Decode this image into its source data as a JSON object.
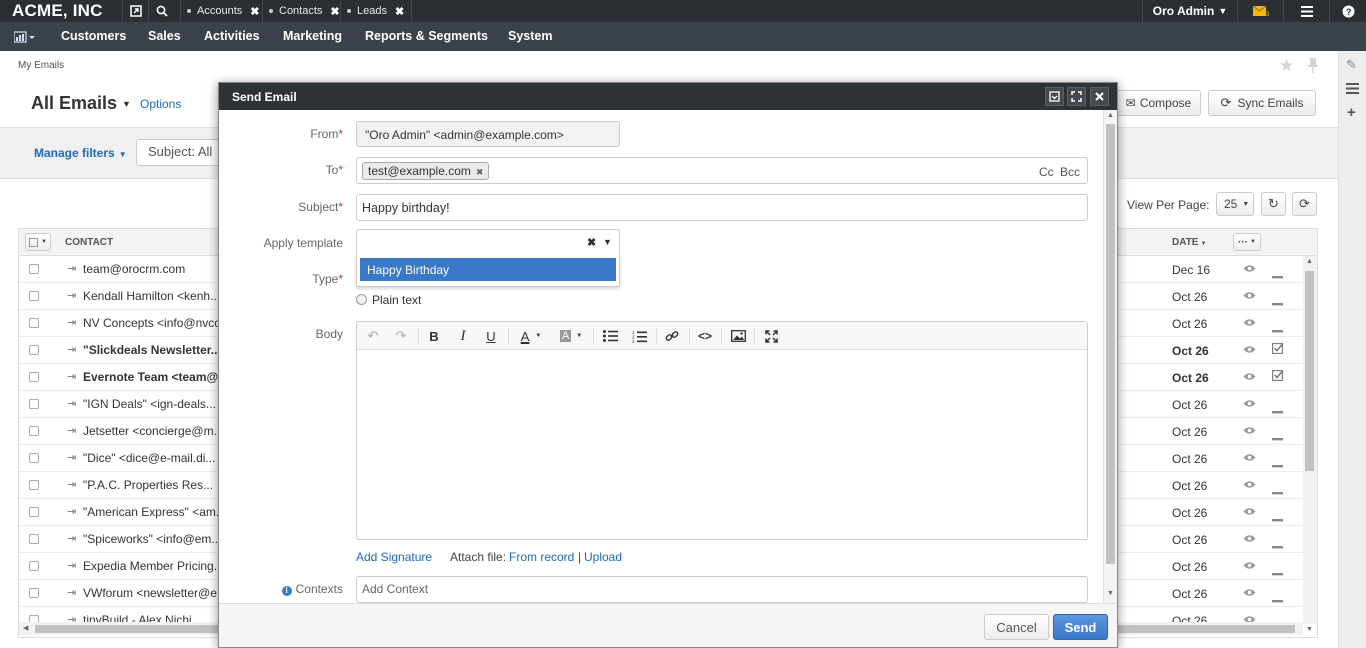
{
  "topbar": {
    "logo": "ACME, INC",
    "tabs": [
      {
        "label": "Accounts"
      },
      {
        "label": "Contacts"
      },
      {
        "label": "Leads"
      }
    ],
    "user": "Oro Admin",
    "close": "✖"
  },
  "menu": [
    "Customers",
    "Sales",
    "Activities",
    "Marketing",
    "Reports & Segments",
    "System"
  ],
  "breadcrumb": "My Emails",
  "page": {
    "title": "All Emails",
    "options": "Options",
    "compose": "Compose",
    "sync": "Sync Emails",
    "manage_filters": "Manage filters",
    "subject_filter": "Subject: All",
    "view_per_page": "View Per Page:",
    "per_page": "25"
  },
  "grid": {
    "col_contact": "CONTACT",
    "col_date": "DATE",
    "rows": [
      {
        "contact": "team@orocrm.com",
        "date": "Dec 16",
        "bold": false,
        "read": false
      },
      {
        "contact": "Kendall Hamilton <kenh...",
        "date": "Oct 26",
        "bold": false,
        "read": false
      },
      {
        "contact": "NV Concepts <info@nvco",
        "date": "Oct 26",
        "bold": false,
        "read": false
      },
      {
        "contact": "\"Slickdeals Newsletter...",
        "date": "Oct 26",
        "bold": true,
        "read": true
      },
      {
        "contact": "Evernote Team <team@",
        "date": "Oct 26",
        "bold": true,
        "read": true
      },
      {
        "contact": "\"IGN Deals\" <ign-deals...",
        "date": "Oct 26",
        "bold": false,
        "read": false
      },
      {
        "contact": "Jetsetter <concierge@m...",
        "date": "Oct 26",
        "bold": false,
        "read": false
      },
      {
        "contact": "\"Dice\" <dice@e-mail.di...",
        "date": "Oct 26",
        "bold": false,
        "read": false
      },
      {
        "contact": "\"P.A.C. Properties Res...",
        "date": "Oct 26",
        "bold": false,
        "read": false
      },
      {
        "contact": "\"American Express\" <am...",
        "date": "Oct 26",
        "bold": false,
        "read": false
      },
      {
        "contact": "\"Spiceworks\" <info@em...",
        "date": "Oct 26",
        "bold": false,
        "read": false
      },
      {
        "contact": "Expedia Member Pricing...",
        "date": "Oct 26",
        "bold": false,
        "read": false
      },
      {
        "contact": "VWforum <newsletter@e...",
        "date": "Oct 26",
        "bold": false,
        "read": false
      },
      {
        "contact": "tinyBuild - Alex Nichi",
        "date": "Oct 26",
        "bold": false,
        "read": false
      }
    ]
  },
  "modal": {
    "title": "Send Email",
    "from_label": "From",
    "from_value": "\"Oro Admin\" <admin@example.com>",
    "to_label": "To",
    "to_tag": "test@example.com",
    "cc": "Cc",
    "bcc": "Bcc",
    "subject_label": "Subject",
    "subject_value": "Happy birthday!",
    "template_label": "Apply template",
    "template_option": "Happy Birthday",
    "type_label": "Type",
    "plain_text": "Plain text",
    "body_label": "Body",
    "add_signature": "Add Signature",
    "attach_file": "Attach file:",
    "from_record": "From record",
    "sep": "|",
    "upload": "Upload",
    "contexts_label": "Contexts",
    "contexts_placeholder": "Add Context",
    "cancel": "Cancel",
    "send": "Send"
  },
  "colors": {
    "accent": "#1e6aba",
    "topbar": "#2b2e33",
    "menubar": "#3c424a",
    "selected": "#3b78c8"
  }
}
